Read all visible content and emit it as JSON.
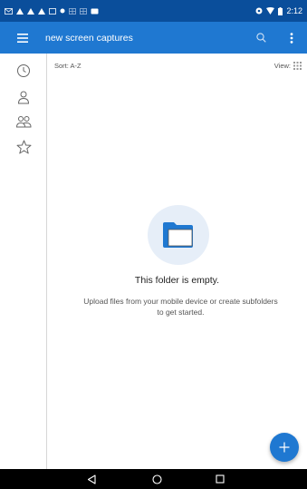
{
  "status_bar": {
    "time": "2:12",
    "left_icons": [
      "mail-icon",
      "warning-icon",
      "warning-icon",
      "warning-icon",
      "cast-icon",
      "dot-icon",
      "grid-icon",
      "grid-icon",
      "photo-icon"
    ],
    "right_icons": [
      "settings-icon",
      "wifi-icon",
      "battery-icon"
    ]
  },
  "app_bar": {
    "title": "new screen captures",
    "menu_icon": "menu-icon",
    "search_icon": "search-icon",
    "more_icon": "more-vertical-icon",
    "color": "#1f78d1"
  },
  "left_rail": {
    "items": [
      {
        "icon": "recent-icon"
      },
      {
        "icon": "person-icon"
      },
      {
        "icon": "shared-icon"
      },
      {
        "icon": "star-icon"
      }
    ]
  },
  "toolbar": {
    "sort_label": "Sort: A-Z",
    "view_label": "View:"
  },
  "empty_state": {
    "icon": "folder-icon",
    "title": "This folder is empty.",
    "subtitle_line1": "Upload files from your mobile device or create subfolders",
    "subtitle_line2": "to get started."
  },
  "fab": {
    "icon": "plus-icon",
    "color": "#1f78d1"
  },
  "nav_bar": {
    "buttons": [
      "back-icon",
      "home-icon",
      "recents-icon"
    ]
  }
}
